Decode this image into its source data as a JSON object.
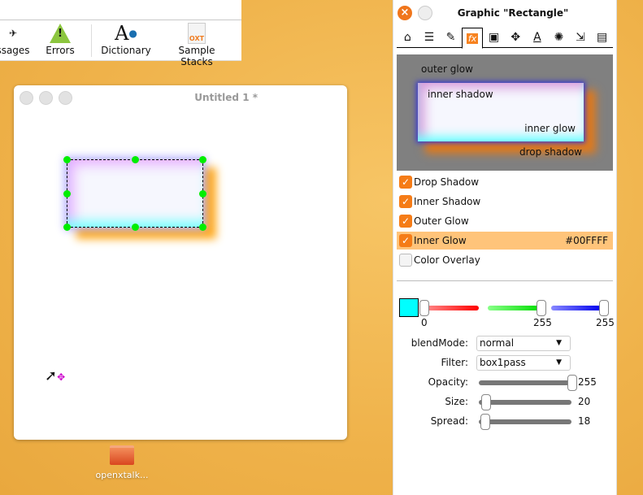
{
  "toolbar": {
    "items": [
      {
        "label": "ssages",
        "icon": "message-icon"
      },
      {
        "label": "Errors",
        "icon": "warning-icon"
      },
      {
        "label": "Dictionary",
        "icon": "dictionary-icon"
      },
      {
        "label": "Sample Stacks",
        "icon": "sample-stacks-icon",
        "badge": "OXT"
      }
    ]
  },
  "document": {
    "title": "Untitled 1 *"
  },
  "palette": {
    "title": "Graphic \"Rectangle\"",
    "close_glyph": "×",
    "tabs": [
      "home-icon",
      "layers-icon",
      "pencil-icon",
      "fx",
      "image-icon",
      "move-icon",
      "text-icon",
      "effects-icon",
      "resize-icon",
      "script-icon"
    ],
    "active_tab": "fx",
    "preview": {
      "outer_glow": "outer glow",
      "inner_shadow": "inner shadow",
      "inner_glow": "inner glow",
      "drop_shadow": "drop shadow"
    },
    "effects": [
      {
        "label": "Drop Shadow",
        "checked": true
      },
      {
        "label": "Inner Shadow",
        "checked": true
      },
      {
        "label": "Outer Glow",
        "checked": true
      },
      {
        "label": "Inner Glow",
        "checked": true,
        "selected": true,
        "value": "#00FFFF"
      },
      {
        "label": "Color Overlay",
        "checked": false
      }
    ],
    "color": {
      "hex": "#00FFFF",
      "r": "0",
      "g": "255",
      "b": "255"
    },
    "blendMode": {
      "label": "blendMode:",
      "value": "normal"
    },
    "filter": {
      "label": "Filter:",
      "value": "box1pass"
    },
    "opacity": {
      "label": "Opacity:",
      "value": "255"
    },
    "size": {
      "label": "Size:",
      "value": "20"
    },
    "spread": {
      "label": "Spread:",
      "value": "18"
    }
  },
  "desktop": {
    "folder_label": "openxtalk..."
  }
}
